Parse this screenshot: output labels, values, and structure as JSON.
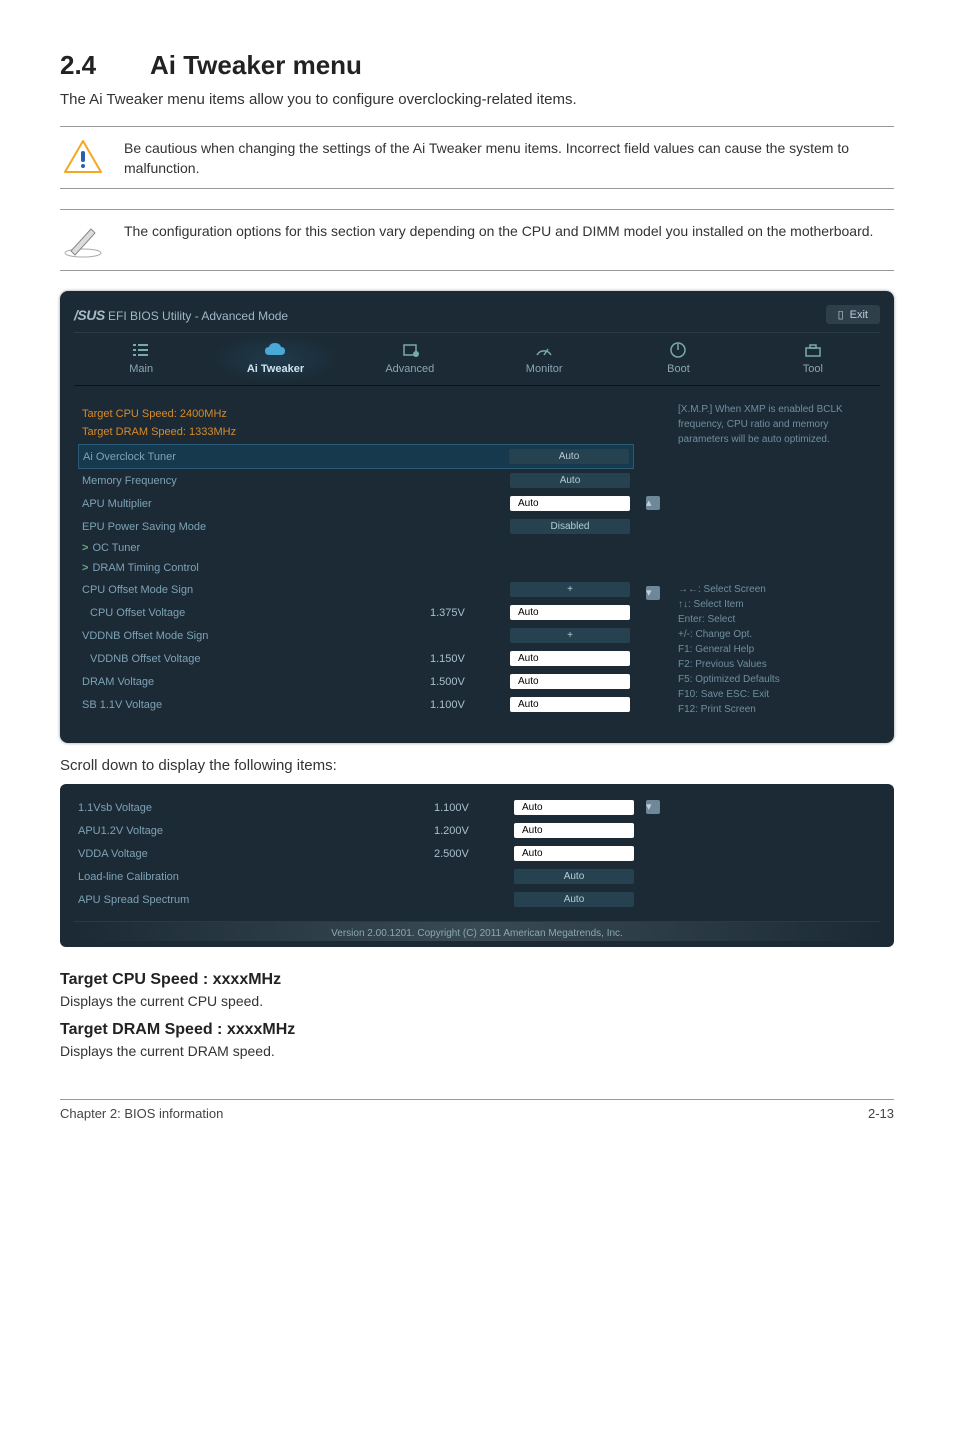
{
  "section": {
    "num": "2.4",
    "title": "Ai Tweaker menu"
  },
  "intro": "The Ai Tweaker menu items allow you to configure overclocking-related items.",
  "warning_note": "Be cautious when changing the settings of the Ai Tweaker menu items. Incorrect field values can cause the system to malfunction.",
  "info_note": "The configuration options for this section vary depending on the CPU and DIMM model you installed on the motherboard.",
  "bios": {
    "brand": "/SUS",
    "title": "EFI BIOS Utility - Advanced Mode",
    "exit": "Exit",
    "tabs": {
      "main": "Main",
      "ai": "Ai  Tweaker",
      "advanced": "Advanced",
      "monitor": "Monitor",
      "boot": "Boot",
      "tool": "Tool"
    },
    "targets": {
      "cpu": "Target CPU Speed: 2400MHz",
      "dram": "Target DRAM Speed: 1333MHz"
    },
    "rows": {
      "ai_overclock": {
        "label": "Ai Overclock Tuner",
        "val": "Auto"
      },
      "mem_freq": {
        "label": "Memory Frequency",
        "val": "Auto"
      },
      "apu_mult": {
        "label": "APU Multiplier",
        "val": "Auto"
      },
      "epu": {
        "label": "EPU Power Saving Mode",
        "val": "Disabled"
      },
      "oc_tuner": {
        "label": "OC Tuner"
      },
      "dram_timing": {
        "label": "DRAM Timing Control"
      },
      "cpu_offset_sign": {
        "label": "CPU Offset Mode Sign",
        "val": "+"
      },
      "cpu_offset_v": {
        "label": "CPU Offset Voltage",
        "mid": "1.375V",
        "val": "Auto"
      },
      "vddnb_sign": {
        "label": "VDDNB Offset Mode Sign",
        "val": "+"
      },
      "vddnb_v": {
        "label": "VDDNB Offset Voltage",
        "mid": "1.150V",
        "val": "Auto"
      },
      "dram_v": {
        "label": "DRAM Voltage",
        "mid": "1.500V",
        "val": "Auto"
      },
      "sb_v": {
        "label": "SB 1.1V Voltage",
        "mid": "1.100V",
        "val": "Auto"
      }
    },
    "help_top": "[X.M.P.] When XMP is enabled BCLK frequency, CPU ratio and memory parameters will be auto optimized.",
    "help_keys": {
      "l1": "→←: Select Screen",
      "l2": "↑↓: Select Item",
      "l3": "Enter: Select",
      "l4": "+/-: Change Opt.",
      "l5": "F1: General Help",
      "l6": "F2: Previous Values",
      "l7": "F5: Optimized Defaults",
      "l8": "F10: Save   ESC: Exit",
      "l9": "F12: Print Screen"
    }
  },
  "scroll_note": "Scroll down to display the following items:",
  "bios2": {
    "rows": {
      "r1": {
        "label": "1.1Vsb Voltage",
        "mid": "1.100V",
        "val": "Auto"
      },
      "r2": {
        "label": "APU1.2V Voltage",
        "mid": "1.200V",
        "val": "Auto"
      },
      "r3": {
        "label": "VDDA Voltage",
        "mid": "2.500V",
        "val": "Auto"
      },
      "r4": {
        "label": "Load-line Calibration",
        "val": "Auto"
      },
      "r5": {
        "label": "APU Spread Spectrum",
        "val": "Auto"
      }
    },
    "footer": "Version 2.00.1201.  Copyright (C) 2011 American Megatrends, Inc."
  },
  "headings": {
    "cpu": "Target CPU Speed : xxxxMHz",
    "cpu_desc": "Displays the current CPU speed.",
    "dram": "Target DRAM Speed : xxxxMHz",
    "dram_desc": "Displays the current DRAM speed."
  },
  "footer": {
    "left": "Chapter 2: BIOS information",
    "right": "2-13"
  }
}
